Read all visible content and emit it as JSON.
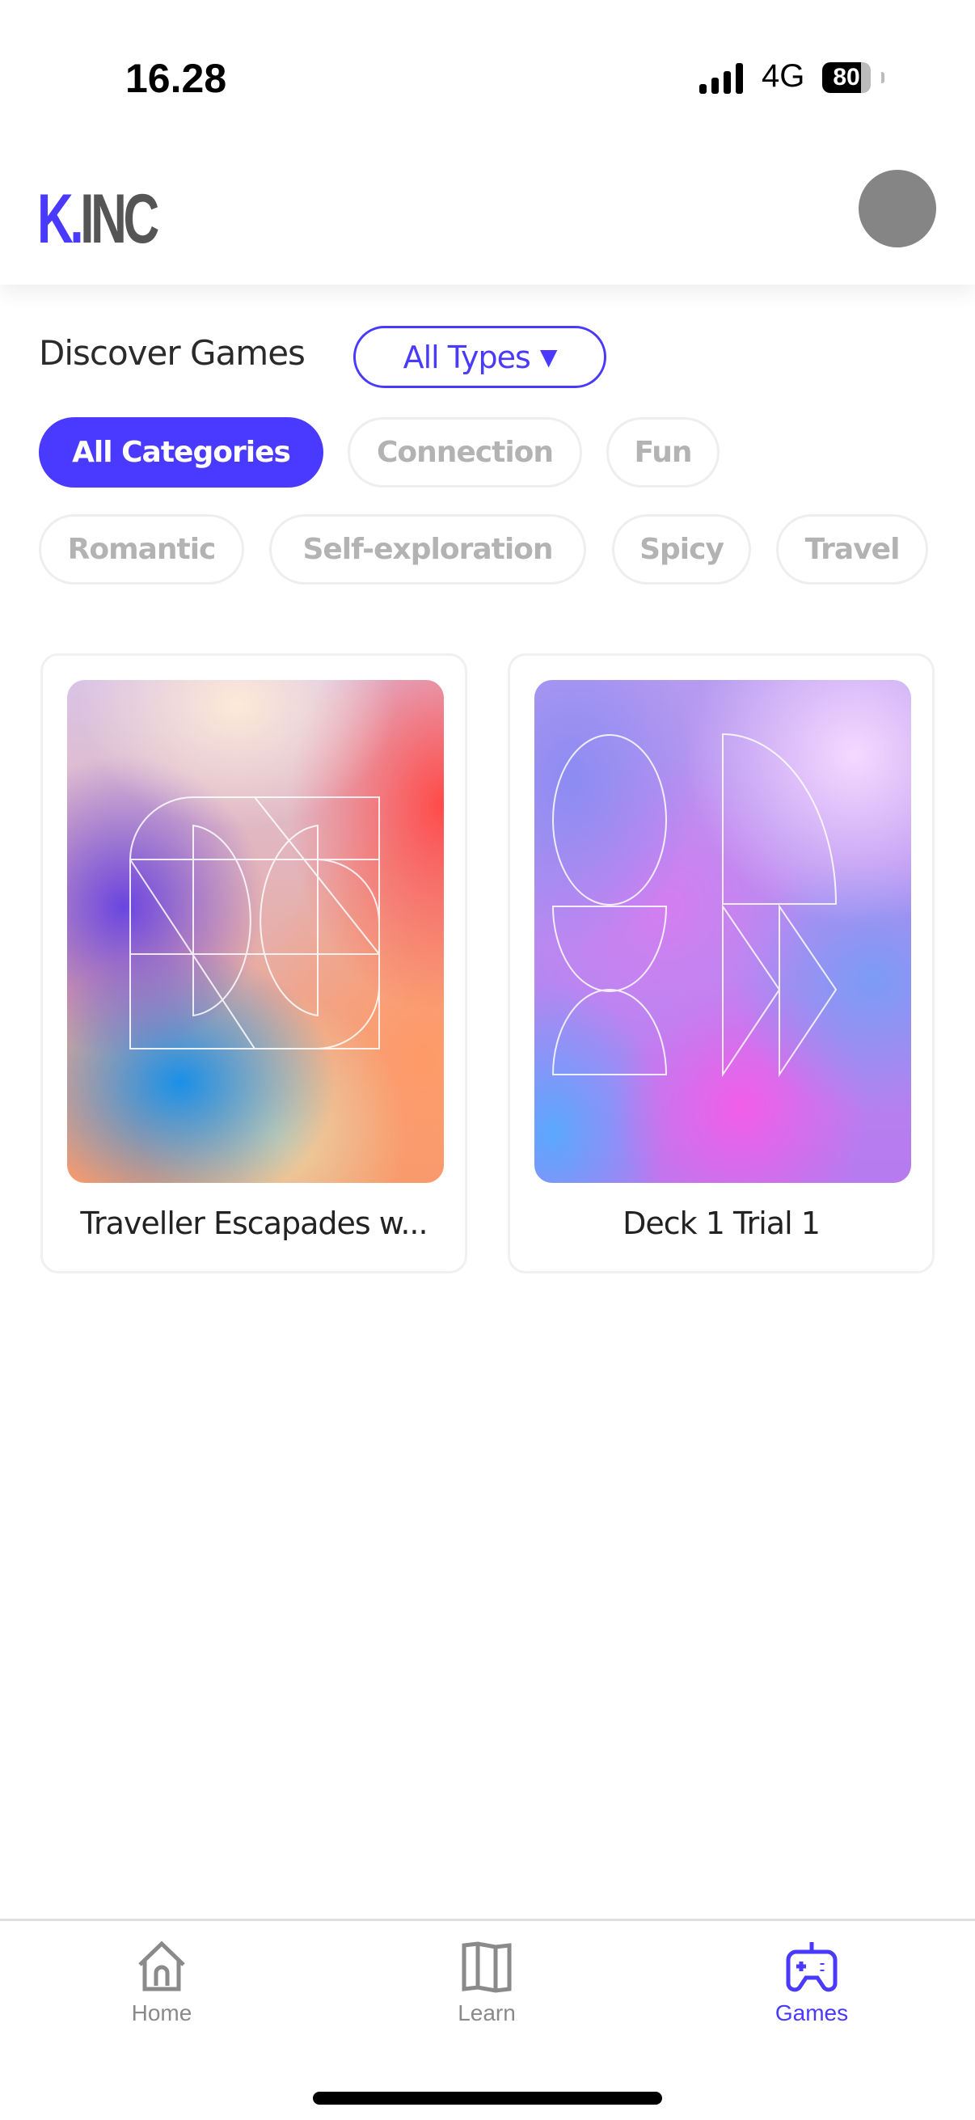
{
  "status_bar": {
    "time": "16.28",
    "network": "4G",
    "battery": "80"
  },
  "header": {
    "logo_prefix": "K.",
    "logo_suffix": "INC",
    "brand_color": "#4a3aff"
  },
  "discover": {
    "title": "Discover Games",
    "type_filter": "All Types",
    "dropdown_arrow": "▼"
  },
  "categories": [
    {
      "label": "All Categories",
      "active": true
    },
    {
      "label": "Connection",
      "active": false
    },
    {
      "label": "Fun",
      "active": false
    },
    {
      "label": "Romantic",
      "active": false
    },
    {
      "label": "Self-exploration",
      "active": false
    },
    {
      "label": "Spicy",
      "active": false
    },
    {
      "label": "Travel",
      "active": false
    }
  ],
  "games": [
    {
      "title": "Traveller Escapades w..."
    },
    {
      "title": "Deck 1 Trial 1"
    }
  ],
  "tabs": [
    {
      "label": "Home",
      "icon": "home-icon",
      "active": false
    },
    {
      "label": "Learn",
      "icon": "map-icon",
      "active": false
    },
    {
      "label": "Games",
      "icon": "gamepad-icon",
      "active": true
    }
  ]
}
